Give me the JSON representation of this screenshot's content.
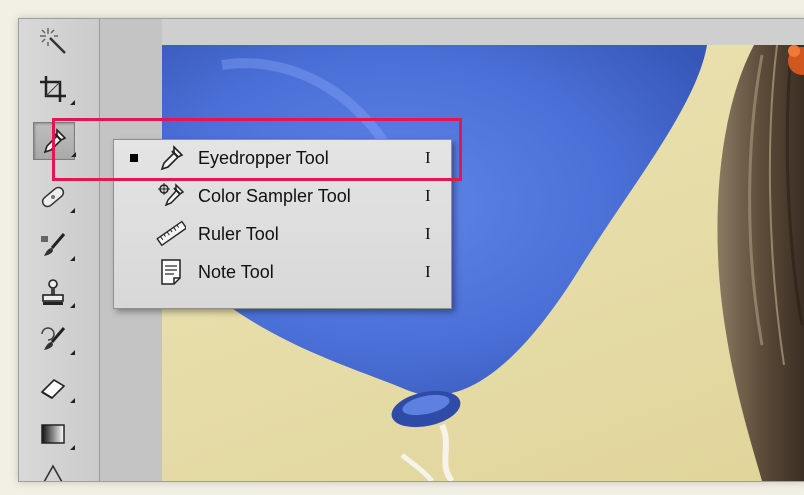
{
  "toolbar": {
    "tools": [
      {
        "icon": "magic-wand-icon"
      },
      {
        "icon": "crop-icon"
      },
      {
        "icon": "eyedropper-icon",
        "active": true
      },
      {
        "icon": "healing-brush-icon"
      },
      {
        "icon": "brush-icon"
      },
      {
        "icon": "clone-stamp-icon"
      },
      {
        "icon": "history-brush-icon"
      },
      {
        "icon": "eraser-icon"
      },
      {
        "icon": "gradient-icon"
      },
      {
        "icon": "pen-icon"
      }
    ]
  },
  "flyout": {
    "items": [
      {
        "label": "Eyedropper Tool",
        "shortcut": "I",
        "icon": "eyedropper-icon",
        "selected": true
      },
      {
        "label": "Color Sampler Tool",
        "shortcut": "I",
        "icon": "color-sampler-icon",
        "selected": false
      },
      {
        "label": "Ruler Tool",
        "shortcut": "I",
        "icon": "ruler-icon",
        "selected": false
      },
      {
        "label": "Note Tool",
        "shortcut": "I",
        "icon": "note-icon",
        "selected": false
      }
    ]
  },
  "colors": {
    "highlight": "#e4164f",
    "balloon": "#4f74d8",
    "background": "#e6dca7"
  }
}
